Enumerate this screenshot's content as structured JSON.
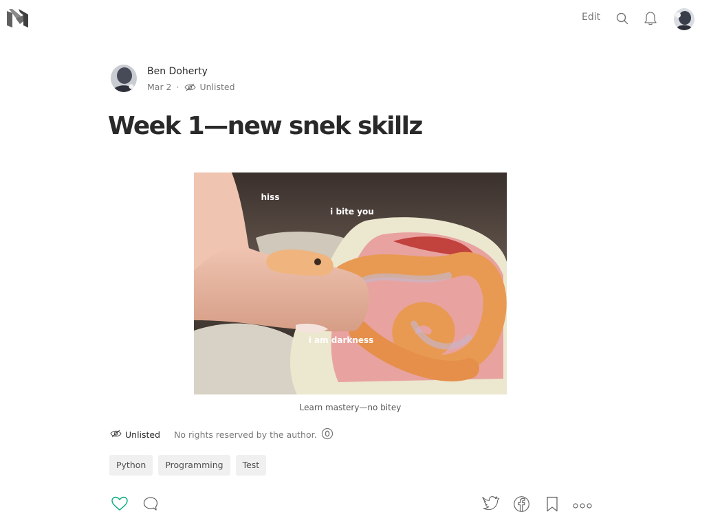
{
  "header": {
    "edit_label": "Edit",
    "icons": [
      "medium-logo-icon",
      "search-icon",
      "bell-icon",
      "avatar"
    ]
  },
  "author": {
    "name": "Ben Doherty",
    "date": "Mar 2",
    "separator": "·",
    "visibility": "Unlisted"
  },
  "post": {
    "title": "Week 1—new snek skillz"
  },
  "figure": {
    "meme_text_1": "hiss",
    "meme_text_2": "i bite you",
    "meme_text_3": "i am darkness",
    "caption": "Learn mastery—no bitey"
  },
  "footer": {
    "visibility": "Unlisted",
    "rights": "No rights reserved by the author.",
    "rights_icon": "zero-icon"
  },
  "tags": [
    "Python",
    "Programming",
    "Test"
  ],
  "actions": {
    "icons": [
      "heart-icon",
      "comment-icon",
      "twitter-icon",
      "facebook-icon",
      "bookmark-icon",
      "more-icon"
    ]
  },
  "colors": {
    "clap_green": "#03a87c",
    "text_primary": "rgba(0,0,0,0.84)",
    "text_secondary": "rgba(0,0,0,0.54)",
    "tag_bg": "#f0f0f0"
  }
}
